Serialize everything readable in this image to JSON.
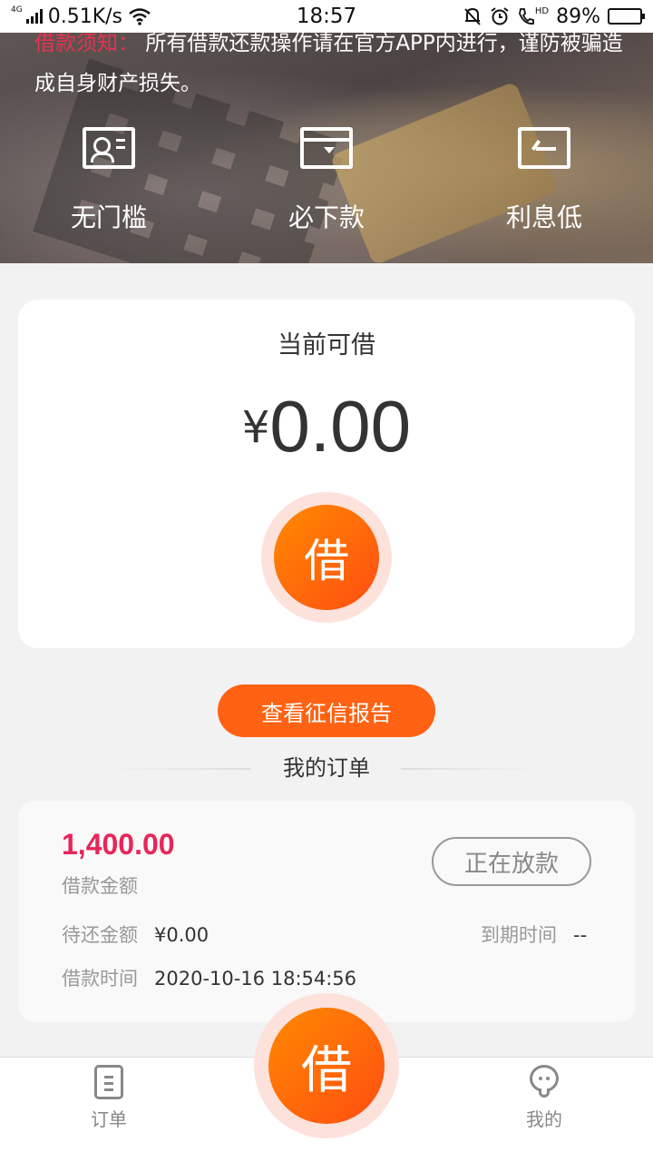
{
  "status_bar": {
    "network": "4G",
    "speed": "0.51K/s",
    "time": "18:57",
    "hd": "HD",
    "battery": "89%",
    "battery_level": 0.89
  },
  "banner": {
    "notice_highlight": "借款须知：",
    "notice_text": "所有借款还款操作请在官方APP内进行，谨防被骗造成自身财产损失。",
    "features": [
      {
        "label": "无门槛",
        "icon": "id-card-icon"
      },
      {
        "label": "必下款",
        "icon": "wallet-icon"
      },
      {
        "label": "利息低",
        "icon": "return-arrow-icon"
      }
    ]
  },
  "loan_card": {
    "label": "当前可借",
    "currency": "¥",
    "amount": "0.00",
    "button": "借"
  },
  "credit_button": "查看征信报告",
  "orders": {
    "title": "我的订单",
    "order": {
      "amount": "1,400.00",
      "amount_label": "借款金额",
      "status": "正在放款",
      "pending_label": "待还金额",
      "pending_value": "¥0.00",
      "due_label": "到期时间",
      "due_value": "--",
      "time_label": "借款时间",
      "time_value": "2020-10-16 18:54:56"
    }
  },
  "bottom_nav": {
    "orders": "订单",
    "center": "借",
    "mine": "我的"
  },
  "colors": {
    "accent": "#fe6212",
    "amount_red": "#e8255a",
    "notice_red": "#e8324f"
  }
}
